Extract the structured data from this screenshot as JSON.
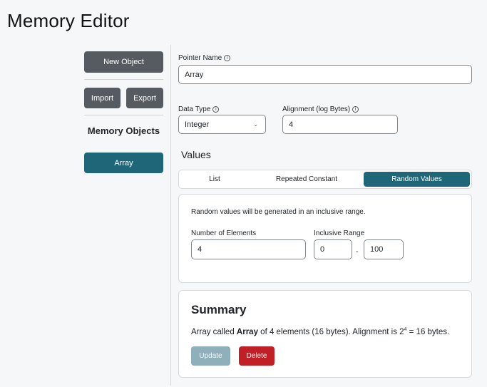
{
  "page": {
    "title": "Memory Editor"
  },
  "sidebar": {
    "new_object_label": "New Object",
    "import_label": "Import",
    "export_label": "Export",
    "heading": "Memory Objects",
    "objects": [
      {
        "label": "Array",
        "selected": true
      }
    ]
  },
  "form": {
    "pointer_name": {
      "label": "Pointer Name",
      "value": "Array"
    },
    "data_type": {
      "label": "Data Type",
      "value": "Integer"
    },
    "alignment": {
      "label": "Alignment (log Bytes)",
      "value": "4"
    }
  },
  "values": {
    "heading": "Values",
    "tabs": [
      {
        "label": "List",
        "active": false
      },
      {
        "label": "Repeated Constant",
        "active": false
      },
      {
        "label": "Random Values",
        "active": true
      }
    ],
    "random": {
      "description": "Random values will be generated in an inclusive range.",
      "num_elements": {
        "label": "Number of Elements",
        "value": "4"
      },
      "range": {
        "label": "Inclusive Range",
        "min": "0",
        "separator": "-",
        "max": "100"
      }
    }
  },
  "summary": {
    "title": "Summary",
    "text_before": "Array called ",
    "name": "Array",
    "text_middle": " of 4 elements (16 bytes). Alignment is 2",
    "exponent": "4",
    "text_after": " = 16 bytes.",
    "update_label": "Update",
    "delete_label": "Delete"
  },
  "colors": {
    "accent": "#1e6678",
    "secondary_button": "#555b61",
    "danger": "#c01f25",
    "disabled": "#8fb0bb"
  },
  "icons": {
    "info": "info-icon",
    "select": "chevron-down-icon"
  }
}
